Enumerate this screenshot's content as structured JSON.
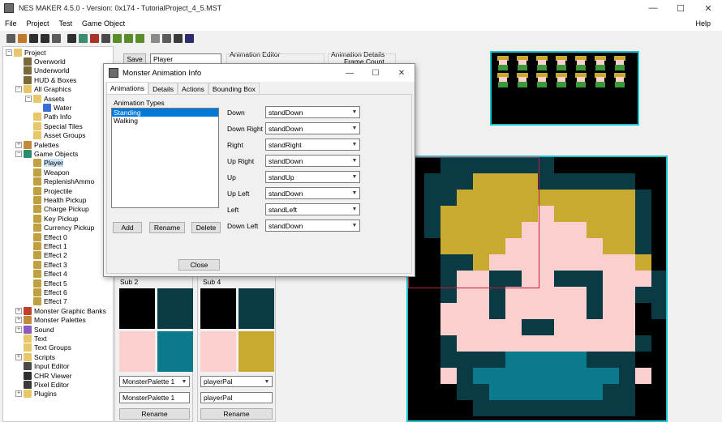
{
  "window": {
    "title": "NES MAKER 4.5.0 - Version: 0x174 - TutorialProject_4_5.MST",
    "minimize_glyph": "—",
    "maximize_glyph": "☐",
    "close_glyph": "✕"
  },
  "menu": {
    "items": [
      "File",
      "Project",
      "Test",
      "Game Object"
    ],
    "help": "Help"
  },
  "toolbar": {
    "icon_colors": [
      "#5b5b5b",
      "#c07a28",
      "#2f2f2f",
      "#2f2f2f",
      "#5b5b5b",
      "#2f2f2f",
      "#3c8c6e",
      "#a8332b",
      "#4a4a4a",
      "#5b8c2a",
      "#5b8c2a",
      "#5b8c2a",
      "#8a8a8a",
      "#5b5b5b",
      "#3a3a3a",
      "#2c2c6e"
    ]
  },
  "tree": {
    "nodes": [
      {
        "label": "Project",
        "expander": "−",
        "icon": "folder-icon",
        "color": "#e8c76a"
      },
      {
        "label": "Overworld",
        "icon": "map-icon",
        "color": "#7a6a3a"
      },
      {
        "label": "Underworld",
        "icon": "map-icon",
        "color": "#7a6a3a"
      },
      {
        "label": "HUD & Boxes",
        "icon": "map-icon",
        "color": "#7a6a3a"
      },
      {
        "label": "All Graphics",
        "expander": "−",
        "icon": "folder-icon",
        "color": "#e8c76a"
      },
      {
        "label": "Assets",
        "expander": "−",
        "icon": "folder-icon",
        "color": "#e8c76a"
      },
      {
        "label": "Water",
        "icon": "globe-icon",
        "color": "#3a6fd8"
      },
      {
        "label": "Path Info",
        "icon": "folder-icon",
        "color": "#e8c76a"
      },
      {
        "label": "Special Tiles",
        "icon": "folder-icon",
        "color": "#e8c76a"
      },
      {
        "label": "Asset Groups",
        "icon": "folder-icon",
        "color": "#e8c76a"
      },
      {
        "label": "Palettes",
        "expander": "+",
        "icon": "palette-icon",
        "color": "#c08a3a"
      },
      {
        "label": "Game Objects",
        "expander": "−",
        "icon": "object-icon",
        "color": "#2c8c6e"
      },
      {
        "label": "Player",
        "icon": "player-icon",
        "color": "#c0a040"
      },
      {
        "label": "Weapon",
        "icon": "object-icon",
        "color": "#c0a040"
      },
      {
        "label": "ReplenishAmmo",
        "icon": "object-icon",
        "color": "#c0a040"
      },
      {
        "label": "Projectile",
        "icon": "object-icon",
        "color": "#c0a040"
      },
      {
        "label": "Health Pickup",
        "icon": "object-icon",
        "color": "#c0a040"
      },
      {
        "label": "Charge Pickup",
        "icon": "object-icon",
        "color": "#c0a040"
      },
      {
        "label": "Key Pickup",
        "icon": "object-icon",
        "color": "#c0a040"
      },
      {
        "label": "Currency Pickup",
        "icon": "object-icon",
        "color": "#c0a040"
      },
      {
        "label": "Effect 0",
        "icon": "object-icon",
        "color": "#c0a040"
      },
      {
        "label": "Effect 1",
        "icon": "object-icon",
        "color": "#c0a040"
      },
      {
        "label": "Effect 2",
        "icon": "object-icon",
        "color": "#c0a040"
      },
      {
        "label": "Effect 3",
        "icon": "object-icon",
        "color": "#c0a040"
      },
      {
        "label": "Effect 4",
        "icon": "object-icon",
        "color": "#c0a040"
      },
      {
        "label": "Effect 5",
        "icon": "object-icon",
        "color": "#c0a040"
      },
      {
        "label": "Effect 6",
        "icon": "object-icon",
        "color": "#c0a040"
      },
      {
        "label": "Effect 7",
        "icon": "object-icon",
        "color": "#c0a040"
      },
      {
        "label": "Monster Graphic Banks",
        "expander": "+",
        "icon": "monster-icon",
        "color": "#c0402a"
      },
      {
        "label": "Monster Palettes",
        "expander": "+",
        "icon": "palette-icon",
        "color": "#c08a3a"
      },
      {
        "label": "Sound",
        "expander": "+",
        "icon": "speaker-icon",
        "color": "#8a5ac0"
      },
      {
        "label": "Text",
        "icon": "folder-icon",
        "color": "#e8c76a"
      },
      {
        "label": "Text Groups",
        "icon": "folder-icon",
        "color": "#e8c76a"
      },
      {
        "label": "Scripts",
        "expander": "+",
        "icon": "folder-icon",
        "color": "#e8c76a"
      },
      {
        "label": "Input Editor",
        "icon": "gamepad-icon",
        "color": "#4a4a4a"
      },
      {
        "label": "CHR Viewer",
        "icon": "chr-icon",
        "color": "#2f2f2f"
      },
      {
        "label": "Pixel Editor",
        "icon": "pencil-icon",
        "color": "#3a3a3a"
      },
      {
        "label": "Plugins",
        "expander": "+",
        "icon": "folder-icon",
        "color": "#e8c76a"
      }
    ]
  },
  "behind": {
    "save_label": "Save",
    "name_value": "Player",
    "animation_editor_label": "Animation Editor",
    "animation_details_label": "Animation Details",
    "frame_count_label": "Frame Count"
  },
  "sub_panels": [
    {
      "title": "Sub 2",
      "colors": [
        "#000000",
        "#0a3a44",
        "#fccfcf",
        "#0a7a8c"
      ],
      "select": "MonsterPalette 1",
      "input": "MonsterPalette 1",
      "button": "Rename"
    },
    {
      "title": "Sub 4",
      "colors": [
        "#000000",
        "#0a3a44",
        "#fccfcf",
        "#c8aa30"
      ],
      "select": "playerPal",
      "input": "playerPal",
      "button": "Rename"
    }
  ],
  "dialog": {
    "title": "Monster Animation Info",
    "tabs": [
      "Animations",
      "Details",
      "Actions",
      "Bounding Box"
    ],
    "types_label": "Animation Types",
    "types": [
      "Standing",
      "Walking"
    ],
    "add_label": "Add",
    "rename_label": "Rename",
    "delete_label": "Delete",
    "close_label": "Close",
    "directions": [
      {
        "label": "Down",
        "value": "standDown"
      },
      {
        "label": "Down Right",
        "value": "standDown"
      },
      {
        "label": "Right",
        "value": "standRight"
      },
      {
        "label": "Up Right",
        "value": "standDown"
      },
      {
        "label": "Up",
        "value": "standUp"
      },
      {
        "label": "Up Left",
        "value": "standDown"
      },
      {
        "label": "Left",
        "value": "standLeft"
      },
      {
        "label": "Down Left",
        "value": "standDown"
      }
    ]
  },
  "canvas": {
    "palette": {
      "k": "#000000",
      "d": "#0a3a44",
      "s": "#fccfcf",
      "h": "#c8aa30",
      "t": "#0a7a8c"
    },
    "rows": [
      "kkdddddddkkkkkkk",
      "kdddhhhhddddddkk",
      "kddhhhhhhhhhhhdk",
      "kdhhhhhhshhhhhdk",
      "kdhhhhhsssshhhdk",
      "kkhhhhsssssshhdk",
      "kkddhssssssssshk",
      "kkdssddssdddsssd",
      "kkdssdsssssdssdd",
      "kksssdsssssdsskd",
      "kksssssddssssskk",
      "kkdsssssssssssdk",
      "kkddddtttttdddkk",
      "kksdtttttttttdsk",
      "kkkddtttttttddkk",
      "kkkkddddddddddkk"
    ]
  },
  "spritesheet": {
    "frames": [
      {
        "hair": "#c8aa30",
        "face": "#fccfcf",
        "tunic": "#3a9a3a"
      },
      {
        "hair": "#c8aa30",
        "face": "#fccfcf",
        "tunic": "#3a9a3a"
      },
      {
        "hair": "#c8aa30",
        "face": "#fccfcf",
        "tunic": "#3a9a3a"
      },
      {
        "hair": "#c8aa30",
        "face": "#fccfcf",
        "tunic": "#3a9a3a"
      },
      {
        "hair": "#c8aa30",
        "face": "#fccfcf",
        "tunic": "#3a9a3a"
      },
      {
        "hair": "#c8aa30",
        "face": "#fccfcf",
        "tunic": "#3a9a3a"
      },
      {
        "hair": "#c8aa30",
        "face": "#fccfcf",
        "tunic": "#3a9a3a"
      },
      {
        "hair": "#c8aa30",
        "face": "#fccfcf",
        "tunic": "#3a9a3a"
      },
      {
        "hair": "#c8aa30",
        "face": "#fccfcf",
        "tunic": "#3a9a3a"
      },
      {
        "hair": "#c8aa30",
        "face": "#fccfcf",
        "tunic": "#3a9a3a"
      },
      {
        "hair": "#c8aa30",
        "face": "#fccfcf",
        "tunic": "#3a9a3a"
      },
      {
        "hair": "#c8aa30",
        "face": "#fccfcf",
        "tunic": "#3a9a3a"
      },
      {
        "hair": "#c8aa30",
        "face": "#fccfcf",
        "tunic": "#3a9a3a"
      },
      {
        "hair": "#c8aa30",
        "face": "#fccfcf",
        "tunic": "#3a9a3a"
      }
    ]
  }
}
